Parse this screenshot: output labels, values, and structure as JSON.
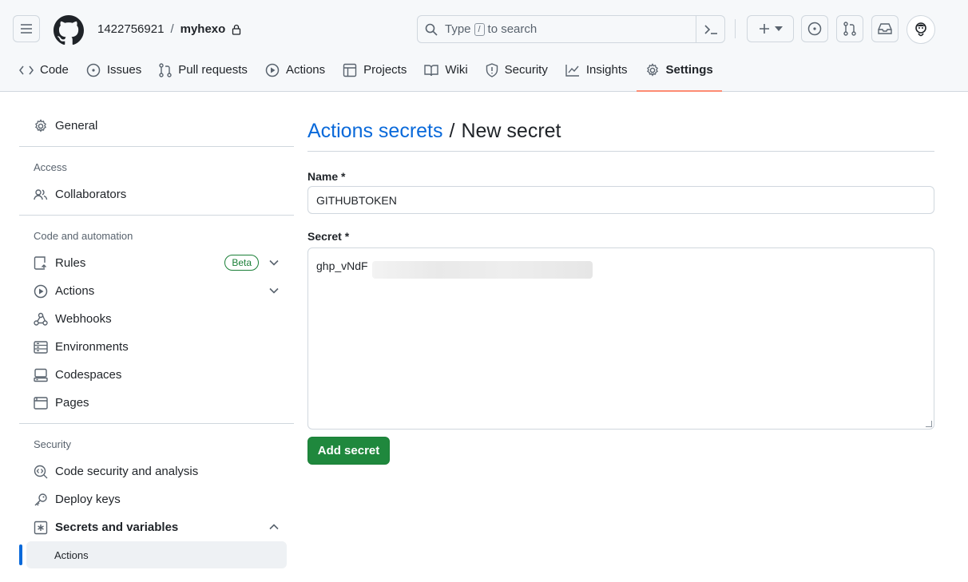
{
  "header": {
    "owner": "1422756921",
    "separator": "/",
    "repo": "myhexo",
    "search": {
      "prefix": "Type",
      "key": "/",
      "suffix": "to search"
    }
  },
  "tabs": [
    {
      "label": "Code",
      "icon": "code-icon"
    },
    {
      "label": "Issues",
      "icon": "issue-icon"
    },
    {
      "label": "Pull requests",
      "icon": "pull-request-icon"
    },
    {
      "label": "Actions",
      "icon": "play-icon"
    },
    {
      "label": "Projects",
      "icon": "table-icon"
    },
    {
      "label": "Wiki",
      "icon": "book-icon"
    },
    {
      "label": "Security",
      "icon": "shield-icon"
    },
    {
      "label": "Insights",
      "icon": "graph-icon"
    },
    {
      "label": "Settings",
      "icon": "gear-icon",
      "active": true
    }
  ],
  "sidebar": {
    "general": "General",
    "access_heading": "Access",
    "collaborators": "Collaborators",
    "automation_heading": "Code and automation",
    "rules": "Rules",
    "rules_badge": "Beta",
    "actions": "Actions",
    "webhooks": "Webhooks",
    "environments": "Environments",
    "codespaces": "Codespaces",
    "pages": "Pages",
    "security_heading": "Security",
    "code_security": "Code security and analysis",
    "deploy_keys": "Deploy keys",
    "secrets": "Secrets and variables",
    "secrets_sub_actions": "Actions"
  },
  "main": {
    "title_link": "Actions secrets",
    "title_sep": "/",
    "title_current": "New secret",
    "name_label": "Name *",
    "name_value": "GITHUBTOKEN",
    "secret_label": "Secret *",
    "secret_value": "ghp_vNdF",
    "submit_label": "Add secret"
  },
  "colors": {
    "link": "#0969da",
    "primary_button": "#1f883d",
    "active_tab_underline": "#fd8c73",
    "beta_badge": "#1a7f37"
  }
}
